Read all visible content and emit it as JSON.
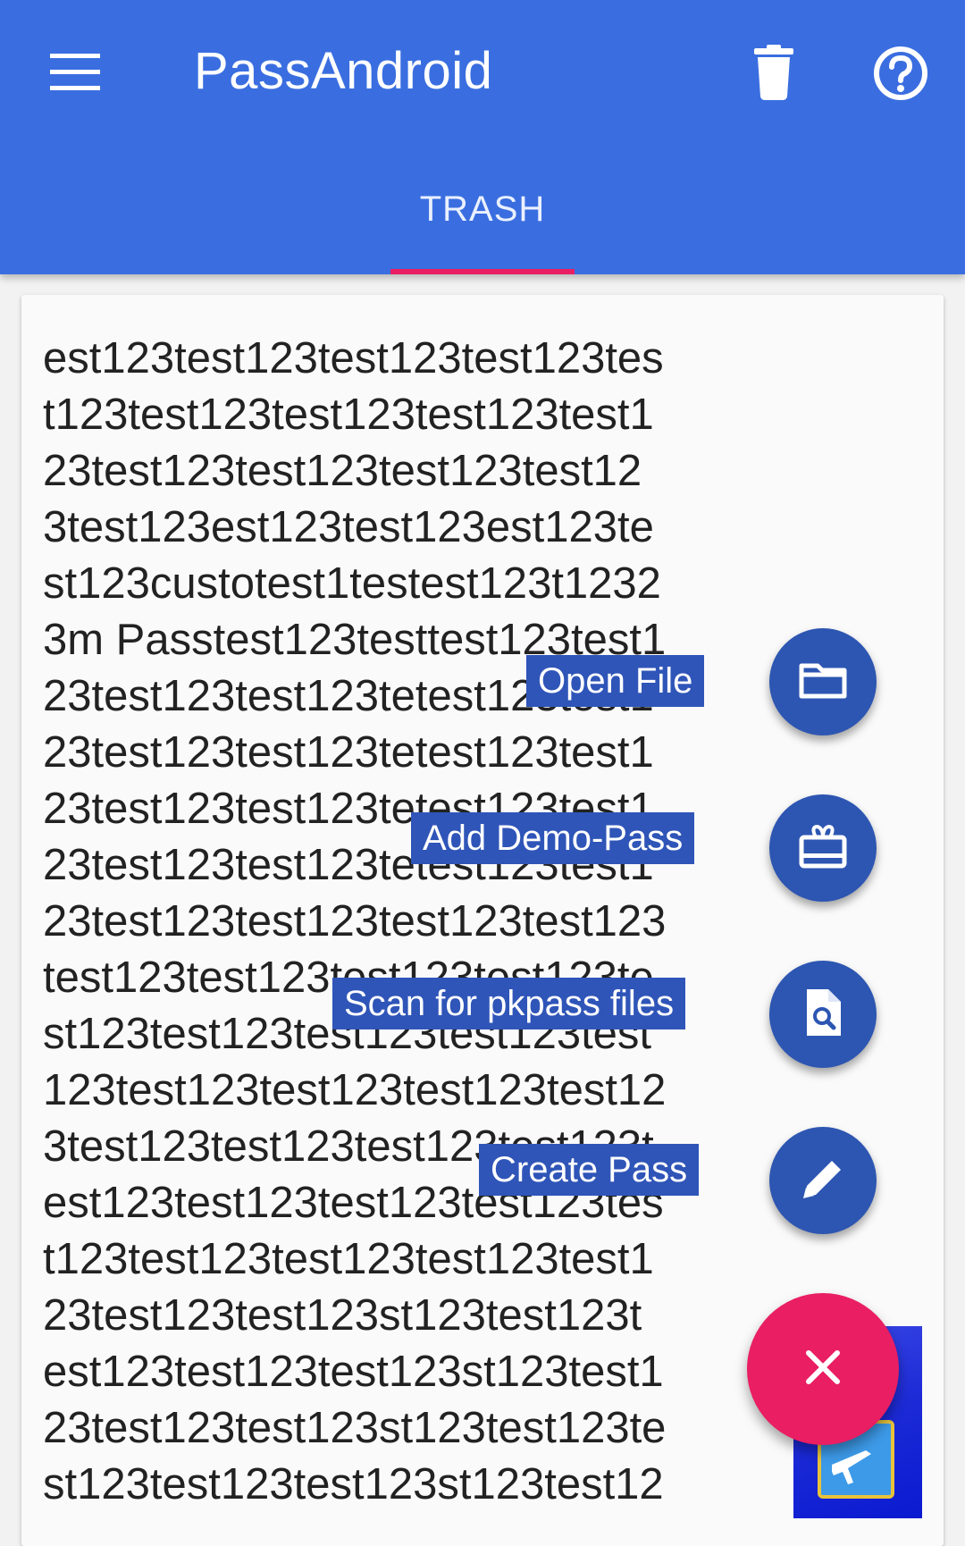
{
  "app": {
    "title": "PassAndroid"
  },
  "tabs": [
    {
      "label": "TRASH",
      "selected": true
    }
  ],
  "pass_card": {
    "lines": [
      "est123test123test123test123tes",
      "t123test123test123test123test1",
      "23test123test123test123test12",
      "3test123est123test123est123te",
      "st123custotest1testest123t1232",
      "3m Passtest123testtest123test1",
      "23test123test123tetest123test1",
      "23test123test123tetest123test1",
      "23test123test123tetest123test1",
      "23test123test123tetest123test1",
      "23test123test123test123test123",
      "test123test123test123test123te",
      "st123test123test123test123test",
      "123test123test123test123test12",
      "3test123test123test123test123t",
      "est123test123test123test123tes",
      "t123test123test123test123test1",
      "23test123test123st123test123t",
      "est123test123test123st123test1",
      "23test123test123st123test123te",
      "st123test123test123st123test12"
    ]
  },
  "fab_menu": {
    "items": [
      {
        "label": "Open File",
        "icon": "folder-icon"
      },
      {
        "label": "Add Demo-Pass",
        "icon": "gift-card-icon"
      },
      {
        "label": "Scan for pkpass files",
        "icon": "file-search-icon"
      },
      {
        "label": "Create Pass",
        "icon": "pencil-icon"
      }
    ],
    "close_icon": "close-icon"
  },
  "colors": {
    "appbar": "#3a6ee0",
    "tab_indicator": "#e91e63",
    "fab_main": "#e91e63",
    "fab_mini": "#2d56b2"
  }
}
